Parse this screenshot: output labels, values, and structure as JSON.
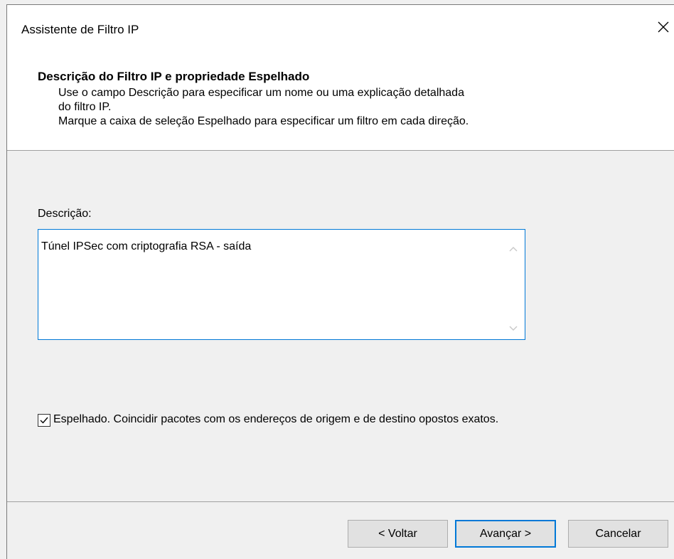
{
  "window": {
    "title": "Assistente de Filtro IP"
  },
  "header": {
    "title": "Descrição do Filtro IP e propriedade Espelhado",
    "desc_line1": "Use o campo Descrição para especificar um nome ou uma explicação detalhada",
    "desc_line2": "do filtro IP.",
    "desc_line3": "Marque a caixa de seleção Espelhado para especificar um filtro em cada direção."
  },
  "form": {
    "description_label": "Descrição:",
    "description_value": "Túnel IPSec com criptografia RSA - saída",
    "mirrored_checked": true,
    "mirrored_label": "Espelhado. Coincidir pacotes com os endereços de origem e de destino opostos exatos."
  },
  "buttons": {
    "back": "< Voltar",
    "next": "Avançar >",
    "cancel": "Cancelar"
  },
  "colors": {
    "focus_accent": "#0078d7",
    "dialog_bg": "#f0f0f0",
    "header_bg": "#ffffff"
  },
  "icons": {
    "close": "close-icon",
    "check": "checkmark-icon",
    "scroll_up": "chevron-up-icon",
    "scroll_down": "chevron-down-icon"
  }
}
